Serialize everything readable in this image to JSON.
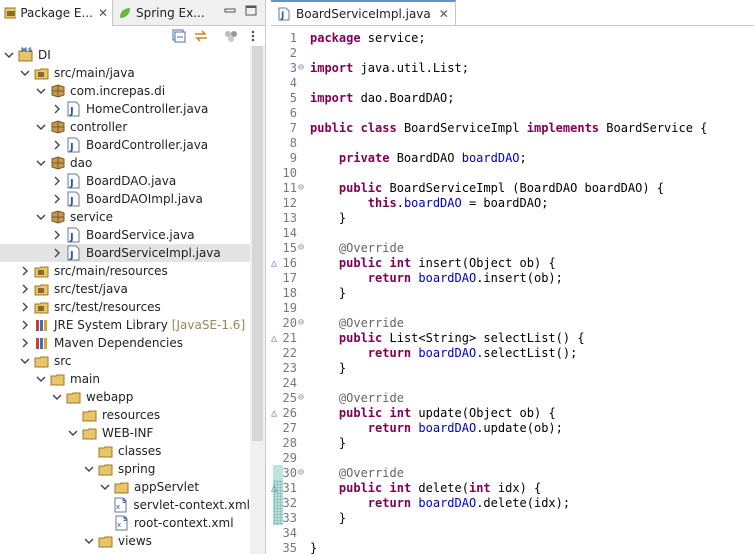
{
  "left_tabs": [
    {
      "label": "Package E..."
    },
    {
      "label": "Spring Ex..."
    }
  ],
  "tree": [
    {
      "label": "DI",
      "level": 0,
      "icon": "project-icon",
      "expanded": true
    },
    {
      "label": "src/main/java",
      "level": 1,
      "icon": "source-folder-icon",
      "expanded": true
    },
    {
      "label": "com.increpas.di",
      "level": 2,
      "icon": "package-icon",
      "expanded": true
    },
    {
      "label": "HomeController.java",
      "level": 3,
      "icon": "java-file-icon",
      "expanded": false
    },
    {
      "label": "controller",
      "level": 2,
      "icon": "package-icon",
      "expanded": true
    },
    {
      "label": "BoardController.java",
      "level": 3,
      "icon": "java-file-icon",
      "expanded": false
    },
    {
      "label": "dao",
      "level": 2,
      "icon": "package-icon",
      "expanded": true
    },
    {
      "label": "BoardDAO.java",
      "level": 3,
      "icon": "java-file-icon",
      "expanded": false
    },
    {
      "label": "BoardDAOImpl.java",
      "level": 3,
      "icon": "java-file-icon",
      "expanded": false
    },
    {
      "label": "service",
      "level": 2,
      "icon": "package-icon",
      "expanded": true
    },
    {
      "label": "BoardService.java",
      "level": 3,
      "icon": "java-file-icon",
      "expanded": false
    },
    {
      "label": "BoardServiceImpl.java",
      "level": 3,
      "icon": "java-file-icon",
      "expanded": false,
      "selected": true
    },
    {
      "label": "src/main/resources",
      "level": 1,
      "icon": "source-folder-icon",
      "expanded": false
    },
    {
      "label": "src/test/java",
      "level": 1,
      "icon": "source-folder-icon",
      "expanded": false
    },
    {
      "label": "src/test/resources",
      "level": 1,
      "icon": "source-folder-icon",
      "expanded": false
    },
    {
      "label": "JRE System Library",
      "decor": "[JavaSE-1.6]",
      "level": 1,
      "icon": "library-icon",
      "expanded": false
    },
    {
      "label": "Maven Dependencies",
      "level": 1,
      "icon": "library-icon",
      "expanded": false
    },
    {
      "label": "src",
      "level": 1,
      "icon": "folder-icon",
      "expanded": true
    },
    {
      "label": "main",
      "level": 2,
      "icon": "folder-icon",
      "expanded": true
    },
    {
      "label": "webapp",
      "level": 3,
      "icon": "folder-icon",
      "expanded": true
    },
    {
      "label": "resources",
      "level": 4,
      "icon": "folder-icon",
      "leaf": true
    },
    {
      "label": "WEB-INF",
      "level": 4,
      "icon": "folder-icon",
      "expanded": true
    },
    {
      "label": "classes",
      "level": 5,
      "icon": "folder-icon",
      "leaf": true
    },
    {
      "label": "spring",
      "level": 5,
      "icon": "folder-icon",
      "expanded": true
    },
    {
      "label": "appServlet",
      "level": 6,
      "icon": "folder-icon",
      "expanded": true
    },
    {
      "label": "servlet-context.xml",
      "level": 7,
      "icon": "xml-file-icon",
      "leaf": true
    },
    {
      "label": "root-context.xml",
      "level": 6,
      "icon": "xml-file-icon",
      "leaf": true
    },
    {
      "label": "views",
      "level": 5,
      "icon": "folder-icon",
      "expanded": true
    }
  ],
  "editor_tab": {
    "label": "BoardServiceImpl.java"
  },
  "code_lines": [
    {
      "n": "1",
      "t": [
        [
          "k",
          "package"
        ],
        [
          "p",
          " service;"
        ]
      ]
    },
    {
      "n": "2",
      "t": []
    },
    {
      "n": "3",
      "fold": true,
      "t": [
        [
          "k",
          "import"
        ],
        [
          "p",
          " java.util.List;"
        ]
      ]
    },
    {
      "n": "4",
      "t": []
    },
    {
      "n": "5",
      "t": [
        [
          "k",
          "import"
        ],
        [
          "p",
          " dao.BoardDAO;"
        ]
      ]
    },
    {
      "n": "6",
      "t": []
    },
    {
      "n": "7",
      "t": [
        [
          "k",
          "public"
        ],
        [
          "p",
          " "
        ],
        [
          "k",
          "class"
        ],
        [
          "p",
          " BoardServiceImpl "
        ],
        [
          "k",
          "implements"
        ],
        [
          "p",
          " BoardService {"
        ]
      ]
    },
    {
      "n": "8",
      "t": []
    },
    {
      "n": "9",
      "t": [
        [
          "p",
          "    "
        ],
        [
          "k",
          "private"
        ],
        [
          "p",
          " BoardDAO "
        ],
        [
          "f",
          "boardDAO"
        ],
        [
          "p",
          ";"
        ]
      ]
    },
    {
      "n": "10",
      "t": []
    },
    {
      "n": "11",
      "fold": true,
      "t": [
        [
          "p",
          "    "
        ],
        [
          "k",
          "public"
        ],
        [
          "p",
          " BoardServiceImpl (BoardDAO boardDAO) {"
        ]
      ]
    },
    {
      "n": "12",
      "t": [
        [
          "p",
          "        "
        ],
        [
          "k",
          "this"
        ],
        [
          "p",
          "."
        ],
        [
          "f",
          "boardDAO"
        ],
        [
          "p",
          " = boardDAO;"
        ]
      ]
    },
    {
      "n": "13",
      "t": [
        [
          "p",
          "    }"
        ]
      ]
    },
    {
      "n": "14",
      "t": []
    },
    {
      "n": "15",
      "fold": true,
      "t": [
        [
          "p",
          "    "
        ],
        [
          "a",
          "@Override"
        ]
      ]
    },
    {
      "n": "16",
      "override": true,
      "t": [
        [
          "p",
          "    "
        ],
        [
          "k",
          "public"
        ],
        [
          "p",
          " "
        ],
        [
          "k",
          "int"
        ],
        [
          "p",
          " insert(Object ob) {"
        ]
      ]
    },
    {
      "n": "17",
      "t": [
        [
          "p",
          "        "
        ],
        [
          "k",
          "return"
        ],
        [
          "p",
          " "
        ],
        [
          "f",
          "boardDAO"
        ],
        [
          "p",
          ".insert(ob);"
        ]
      ]
    },
    {
      "n": "18",
      "t": [
        [
          "p",
          "    }"
        ]
      ]
    },
    {
      "n": "19",
      "t": []
    },
    {
      "n": "20",
      "fold": true,
      "t": [
        [
          "p",
          "    "
        ],
        [
          "a",
          "@Override"
        ]
      ]
    },
    {
      "n": "21",
      "override": true,
      "t": [
        [
          "p",
          "    "
        ],
        [
          "k",
          "public"
        ],
        [
          "p",
          " List<String> selectList() {"
        ]
      ]
    },
    {
      "n": "22",
      "t": [
        [
          "p",
          "        "
        ],
        [
          "k",
          "return"
        ],
        [
          "p",
          " "
        ],
        [
          "f",
          "boardDAO"
        ],
        [
          "p",
          ".selectList();"
        ]
      ]
    },
    {
      "n": "23",
      "t": [
        [
          "p",
          "    }"
        ]
      ]
    },
    {
      "n": "24",
      "t": []
    },
    {
      "n": "25",
      "fold": true,
      "t": [
        [
          "p",
          "    "
        ],
        [
          "a",
          "@Override"
        ]
      ]
    },
    {
      "n": "26",
      "override": true,
      "t": [
        [
          "p",
          "    "
        ],
        [
          "k",
          "public"
        ],
        [
          "p",
          " "
        ],
        [
          "k",
          "int"
        ],
        [
          "p",
          " update(Object ob) {"
        ]
      ]
    },
    {
      "n": "27",
      "t": [
        [
          "p",
          "        "
        ],
        [
          "k",
          "return"
        ],
        [
          "p",
          " "
        ],
        [
          "f",
          "boardDAO"
        ],
        [
          "p",
          ".update(ob);"
        ]
      ]
    },
    {
      "n": "28",
      "t": [
        [
          "p",
          "    }"
        ]
      ]
    },
    {
      "n": "29",
      "t": []
    },
    {
      "n": "30",
      "fold": true,
      "hl": true,
      "t": [
        [
          "p",
          "    "
        ],
        [
          "a",
          "@Override"
        ]
      ]
    },
    {
      "n": "31",
      "override": true,
      "hl": true,
      "t": [
        [
          "p",
          "    "
        ],
        [
          "k",
          "public"
        ],
        [
          "p",
          " "
        ],
        [
          "k",
          "int"
        ],
        [
          "p",
          " delete("
        ],
        [
          "k",
          "int"
        ],
        [
          "p",
          " idx) {"
        ]
      ]
    },
    {
      "n": "32",
      "hl": true,
      "t": [
        [
          "p",
          "        "
        ],
        [
          "k",
          "return"
        ],
        [
          "p",
          " "
        ],
        [
          "f",
          "boardDAO"
        ],
        [
          "p",
          ".delete(idx);"
        ]
      ]
    },
    {
      "n": "33",
      "hl": true,
      "t": [
        [
          "p",
          "    }"
        ]
      ]
    },
    {
      "n": "34",
      "t": []
    },
    {
      "n": "35",
      "t": [
        [
          "p",
          "}"
        ]
      ]
    }
  ],
  "colors": {
    "keyword": "#7f0055",
    "field": "#0000c0",
    "annotation": "#646464",
    "line_number": "#787878"
  }
}
